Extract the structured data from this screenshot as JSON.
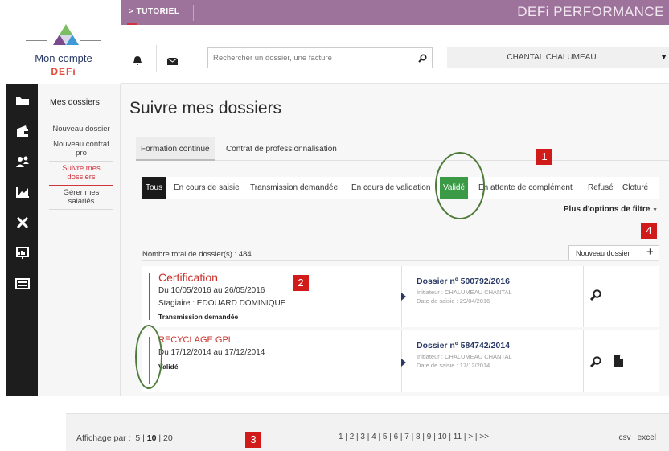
{
  "logo": {
    "text": "Mon compte",
    "brand": "DEFi"
  },
  "topbar": {
    "tutorial": "> TUTORIEL",
    "brand": "DEFi PERFORMANCE"
  },
  "header": {
    "search_placeholder": "Rechercher un dossier, une facture",
    "user_name": "CHANTAL CHALUMEAU"
  },
  "rail": {
    "icons": [
      "folder-icon",
      "wallet-icon",
      "users-icon",
      "chart-icon",
      "tools-icon",
      "presentation-icon",
      "card-icon"
    ]
  },
  "sidenav": {
    "title": "Mes dossiers",
    "items": [
      {
        "label": "Nouveau dossier",
        "active": false
      },
      {
        "label": "Nouveau contrat pro",
        "active": false
      },
      {
        "label": "Suivre mes dossiers",
        "active": true
      },
      {
        "label": "Gérer mes salariés",
        "active": false
      }
    ]
  },
  "page": {
    "title": "Suivre mes dossiers"
  },
  "subtabs": [
    "Formation continue",
    "Contrat de professionnalisation"
  ],
  "filters": {
    "tabs": [
      "Tous",
      "En cours de saisie",
      "Transmission demandée",
      "En cours de validation",
      "Validé",
      "En attente de complément",
      "Refusé",
      "Cloturé"
    ],
    "more": "Plus d'options de filtre"
  },
  "list": {
    "total": "Nombre total de dossier(s) : 484",
    "new_button": "Nouveau dossier",
    "new_plus": "+"
  },
  "cards": [
    {
      "title": "Certification",
      "dates": "Du 10/05/2016 au 26/05/2016",
      "trainee": "Stagiaire : EDOUARD DOMINIQUE",
      "status": "Transmission demandée",
      "status_color": "#2d6db5",
      "dossier": "Dossier nº 500792/2016",
      "initiator": "Initiateur : CHALUMEAU CHANTAL",
      "entry_date": "Date de saisie : 29/04/2016"
    },
    {
      "title": "RECYCLAGE GPL",
      "dates": "Du 17/12/2014 au 17/12/2014",
      "status": "Validé",
      "status_color": "#3a9a45",
      "dossier": "Dossier nº 584742/2014",
      "initiator": "Initiateur : CHALUMEAU CHANTAL",
      "entry_date": "Date de saisie : 17/12/2014"
    }
  ],
  "footer": {
    "display_label": "Affichage par :",
    "display_options": [
      "5",
      "10",
      "20"
    ],
    "display_selected": "10",
    "pages": "1 | 2 | 3 | 4 | 5 | 6 | 7 | 8 | 9 | 10 | 11 | > | >>",
    "export": "csv | excel"
  },
  "annotations": [
    "1",
    "2",
    "3",
    "4"
  ],
  "colors": {
    "topbar": "#9e739b",
    "accent_red": "#d0343e",
    "valid_green": "#3a9a45",
    "navy": "#2a3a66"
  }
}
